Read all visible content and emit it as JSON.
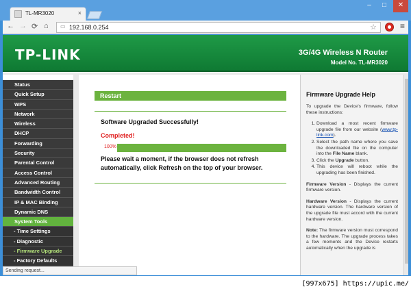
{
  "window": {
    "minimize": "–",
    "maximize": "□",
    "close": "✕"
  },
  "tab": {
    "title": "TL-MR3020",
    "close": "×"
  },
  "toolbar": {
    "back": "←",
    "forward": "→",
    "reload": "⟳",
    "home": "⌂",
    "url": "192.168.0.254",
    "menu": "≡"
  },
  "banner": {
    "logo": "TP-LINK",
    "product": "3G/4G Wireless N Router",
    "model": "Model No. TL-MR3020"
  },
  "sidebar": {
    "items": [
      {
        "label": "Status"
      },
      {
        "label": "Quick Setup"
      },
      {
        "label": "WPS"
      },
      {
        "label": "Network"
      },
      {
        "label": "Wireless"
      },
      {
        "label": "DHCP"
      },
      {
        "label": "Forwarding"
      },
      {
        "label": "Security"
      },
      {
        "label": "Parental Control"
      },
      {
        "label": "Access Control"
      },
      {
        "label": "Advanced Routing"
      },
      {
        "label": "Bandwidth Control"
      },
      {
        "label": "IP & MAC Binding"
      },
      {
        "label": "Dynamic DNS"
      },
      {
        "label": "System Tools"
      },
      {
        "label": "- Time Settings"
      },
      {
        "label": "- Diagnostic"
      },
      {
        "label": "- Firmware Upgrade"
      },
      {
        "label": "- Factory Defaults"
      }
    ]
  },
  "main": {
    "section_title": "Restart",
    "success": "Software Upgraded Successfully!",
    "completed": "Completed!",
    "progress_label": "100%",
    "progress_value": 100,
    "notice": "Please wait a moment, if the browser does not refresh automatically, click Refresh on the top of your browser."
  },
  "help": {
    "title": "Firmware Upgrade Help",
    "intro": "To upgrade the Device's firmware, follow these instructions:",
    "step1_pre": "Download a most recent firmware upgrade file from our website (",
    "step1_link": "www.tp-link.com",
    "step1_post": ").",
    "step2_pre": "Select the path name where you save the downloaded file on the computer into the ",
    "step2_bold": "File Name",
    "step2_post": " blank.",
    "step3_pre": "Click the ",
    "step3_bold": "Upgrade",
    "step3_post": " button.",
    "step4": "This device will reboot while the upgrading has been finished.",
    "fw_label": "Firmware Version",
    "fw_text": " - Displays the current firmware version.",
    "hw_label": "Hardware Version",
    "hw_text": " - Displays the current hardware version. The hardware version of the upgrade file must accord with the current hardware version.",
    "note_label": "Note:",
    "note_text": " The firmware version must correspond to the hardware. The upgrade process takes a few moments and the Device restarts automatically when the upgrade is"
  },
  "status": {
    "text": "Sending request..."
  },
  "caption": {
    "text": "[997x675] https://upic.me/"
  }
}
